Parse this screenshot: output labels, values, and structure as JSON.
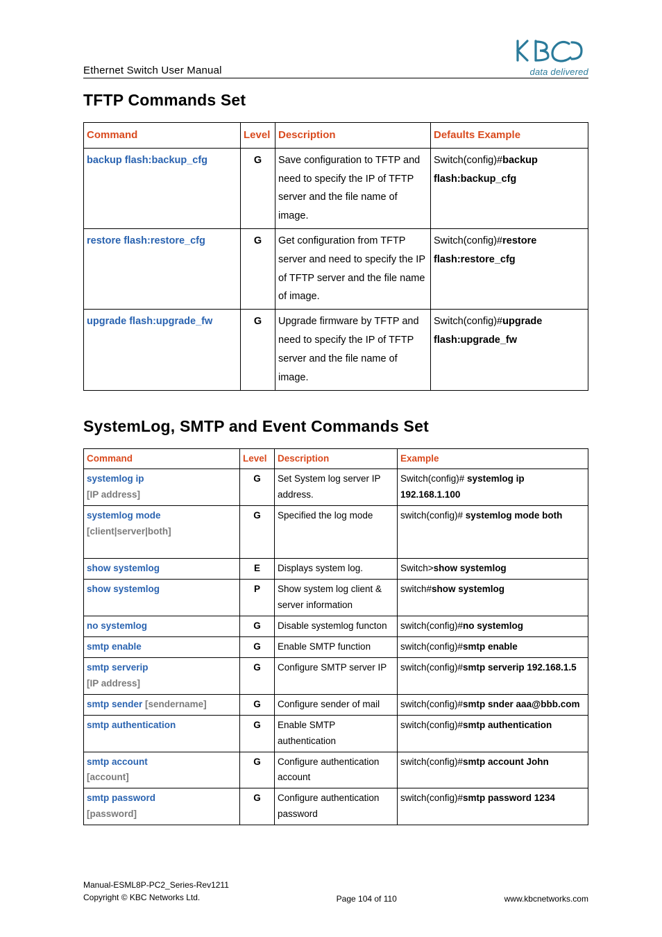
{
  "header": {
    "title": "Ethernet Switch User Manual",
    "tagline": "data delivered"
  },
  "section1": {
    "heading": "TFTP Commands Set",
    "headers": {
      "c1": "Command",
      "c2": "Level",
      "c3": "Description",
      "c4": "Defaults Example"
    },
    "rows": [
      {
        "command": "backup flash:backup_cfg",
        "level": "G",
        "description": "Save configuration to TFTP and need to specify the IP of TFTP server and the file name of image.",
        "example_prefix": "Switch(config)#",
        "example_bold": "backup flash:backup_cfg"
      },
      {
        "command": "restore flash:restore_cfg",
        "level": "G",
        "description": "Get configuration from TFTP server and need to specify the IP of TFTP server and the file name of image.",
        "example_prefix": "Switch(config)#",
        "example_bold": "restore flash:restore_cfg"
      },
      {
        "command": "upgrade flash:upgrade_fw",
        "level": "G",
        "description": "Upgrade firmware by TFTP and need to specify the IP of TFTP server and the file name of image.",
        "example_prefix": "Switch(config)#",
        "example_bold": "upgrade flash:upgrade_fw"
      }
    ]
  },
  "section2": {
    "heading": "SystemLog, SMTP and Event Commands Set",
    "headers": {
      "c1": "Command",
      "c2": "Level",
      "c3": "Description",
      "c4": "Example"
    },
    "rows": [
      {
        "command": "systemlog ip",
        "arg": "[IP address]",
        "level": "G",
        "description": "Set System log server IP address.",
        "example_prefix": "Switch(config)# ",
        "example_bold": "systemlog ip 192.168.1.100"
      },
      {
        "command": "systemlog mode",
        "arg": "[client|server|both]",
        "level": "G",
        "description": "Specified the log mode",
        "example_prefix": "switch(config)# ",
        "example_bold": "systemlog mode both"
      },
      {
        "command": "show systemlog",
        "arg": "",
        "level": "E",
        "description": "Displays system log.",
        "example_prefix": "Switch>",
        "example_bold": "show systemlog"
      },
      {
        "command": "show systemlog",
        "arg": "",
        "level": "P",
        "description": "Show system log client & server information",
        "example_prefix": "switch#",
        "example_bold": "show systemlog"
      },
      {
        "command": "no systemlog",
        "arg": "",
        "level": "G",
        "description": "Disable systemlog functon",
        "example_prefix": "switch(config)#",
        "example_bold": "no systemlog"
      },
      {
        "command": "smtp enable",
        "arg": "",
        "level": "G",
        "description": "Enable SMTP function",
        "example_prefix": "switch(config)#",
        "example_bold": "smtp enable"
      },
      {
        "command": "smtp serverip",
        "arg": "[IP address]",
        "level": "G",
        "description": "Configure SMTP server IP",
        "example_prefix": "switch(config)#",
        "example_bold": "smtp serverip 192.168.1.5"
      },
      {
        "command": "smtp sender",
        "arg": "[sendername]",
        "arg_inline": true,
        "level": "G",
        "description": "Configure sender of mail",
        "example_prefix": "switch(config)#",
        "example_bold": "smtp snder aaa@bbb.com"
      },
      {
        "command": "smtp authentication",
        "arg": "",
        "level": "G",
        "description": "Enable SMTP authentication",
        "example_prefix": "switch(config)#",
        "example_bold": "smtp authentication"
      },
      {
        "command": "smtp account",
        "arg": "[account]",
        "level": "G",
        "description": "Configure authentication account",
        "example_prefix": "switch(config)#",
        "example_bold": "smtp account John"
      },
      {
        "command": "smtp password",
        "arg": "[password]",
        "level": "G",
        "description": "Configure authentication password",
        "example_prefix": "switch(config)#",
        "example_bold": "smtp password 1234"
      }
    ]
  },
  "footer": {
    "line1": "Manual-ESML8P-PC2_Series-Rev1211",
    "line2": "Copyright © KBC Networks Ltd.",
    "center": "Page 104 of 110",
    "right": "www.kbcnetworks.com"
  }
}
